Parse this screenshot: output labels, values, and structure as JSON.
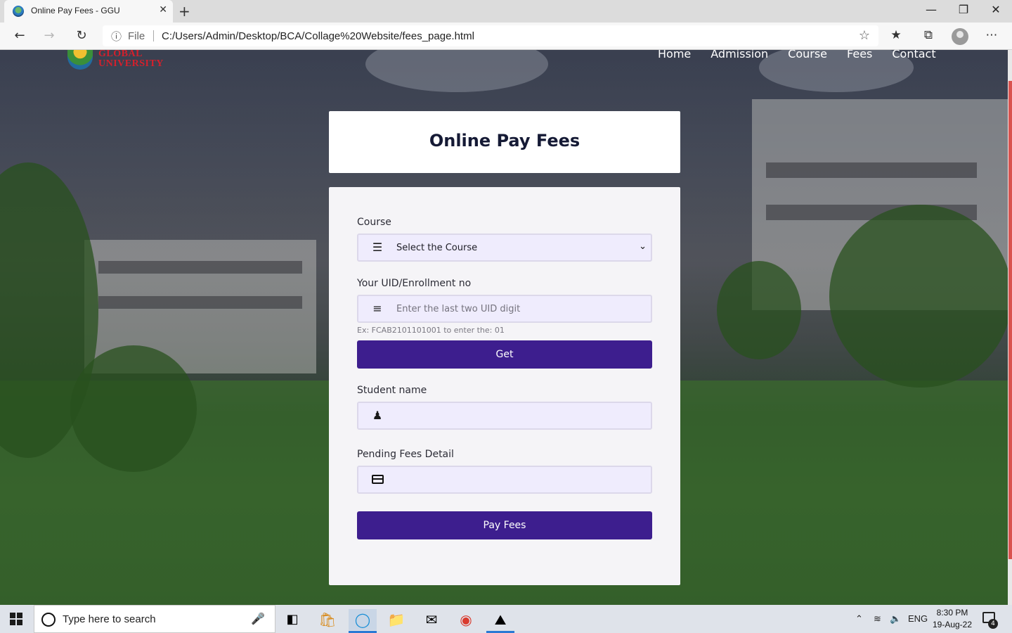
{
  "browser": {
    "tab_title": "Online Pay Fees - GGU",
    "tab_close": "✕",
    "new_tab": "+",
    "url_prefix": "File",
    "url": "C:/Users/Admin/Desktop/BCA/Collage%20Website/fees_page.html"
  },
  "site": {
    "logo_line1": "GLOBAL",
    "logo_line2": "UNIVERSITY",
    "nav": [
      "Home",
      "Admission",
      "Course",
      "Fees",
      "Contact"
    ]
  },
  "page": {
    "title": "Online Pay Fees",
    "course_label": "Course",
    "course_selected": "Select the Course",
    "uid_label": "Your UID/Enrollment no",
    "uid_placeholder": "Enter the last two UID digit",
    "uid_hint": "Ex: FCAB2101101001 to enter the: 01",
    "get_button": "Get",
    "student_label": "Student name",
    "student_value": "",
    "pending_label": "Pending Fees Detail",
    "pending_value": "",
    "pay_button": "Pay Fees"
  },
  "icons": {
    "course": "bars-icon",
    "uid": "list-icon",
    "student": "user-icon",
    "pending": "credit-card-icon"
  },
  "colors": {
    "primary_button": "#3d1e8e",
    "field_bg": "#efecfd",
    "logo_red": "#d4202c"
  },
  "taskbar": {
    "search_placeholder": "Type here to search",
    "language": "ENG",
    "time": "8:30 PM",
    "date": "19-Aug-22",
    "notification_count": "4"
  }
}
